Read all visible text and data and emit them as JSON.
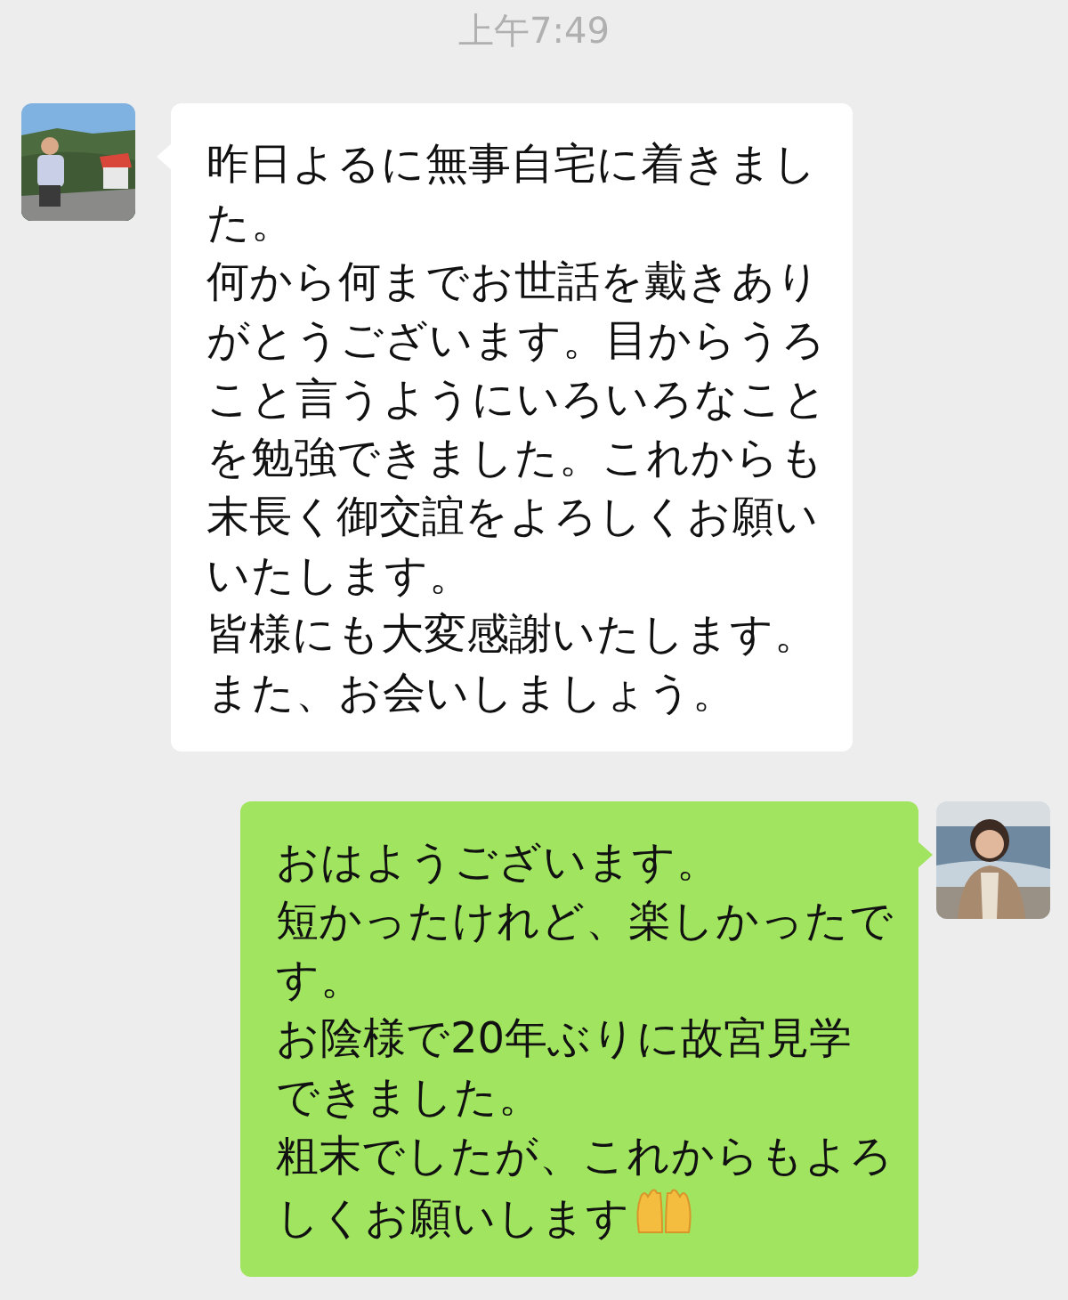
{
  "timestamp": "上午7:49",
  "messages": [
    {
      "kind": "incoming",
      "lines": [
        "昨日よるに無事自宅に着きまし",
        "た。",
        "何から何までお世話を戴きあり",
        "がとうございます。目からうろ",
        "こと言うようにいろいろなこと",
        "を勉強できました。これからも",
        "末長く御交誼をよろしくお願い",
        "いたします。",
        "皆様にも大変感謝いたします。",
        "また、お会いしましょう。"
      ],
      "ends_with_emoji": false
    },
    {
      "kind": "outgoing",
      "lines": [
        "おはようございます。",
        "短かったけれど、楽しかったで",
        "す。",
        "お陰様で20年ぶりに故宮見学",
        "できました。",
        "粗末でしたが、これからもよろ",
        "しくお願いします"
      ],
      "ends_with_emoji": true
    }
  ]
}
